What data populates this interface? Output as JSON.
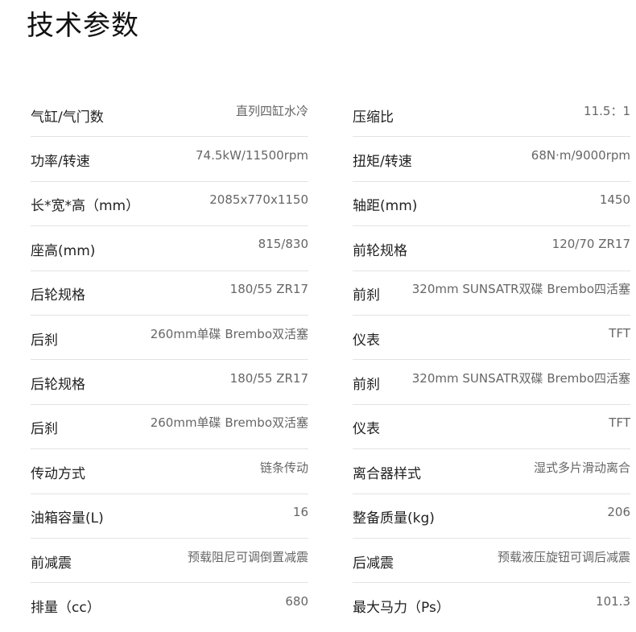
{
  "page": {
    "title": "技术参数"
  },
  "specs": [
    {
      "label": "气缸/气门数",
      "value": "直列四缸水冷"
    },
    {
      "label": "压缩比",
      "value": "11.5：1"
    },
    {
      "label": "功率/转速",
      "value": "74.5kW/11500rpm"
    },
    {
      "label": "扭矩/转速",
      "value": "68N·m/9000rpm"
    },
    {
      "label": "长*宽*高（mm）",
      "value": "2085x770x1150"
    },
    {
      "label": "轴距(mm)",
      "value": "1450"
    },
    {
      "label": "座高(mm)",
      "value": "815/830"
    },
    {
      "label": "前轮规格",
      "value": "120/70 ZR17"
    },
    {
      "label": "后轮规格",
      "value": "180/55 ZR17"
    },
    {
      "label": "前刹",
      "value": "320mm SUNSATR双碟 Brembo四活塞"
    },
    {
      "label": "后刹",
      "value": "260mm单碟 Brembo双活塞"
    },
    {
      "label": "仪表",
      "value": "TFT"
    },
    {
      "label": "后轮规格",
      "value": "180/55 ZR17"
    },
    {
      "label": "前刹",
      "value": "320mm SUNSATR双碟 Brembo四活塞"
    },
    {
      "label": "后刹",
      "value": "260mm单碟 Brembo双活塞"
    },
    {
      "label": "仪表",
      "value": "TFT"
    },
    {
      "label": "传动方式",
      "value": "链条传动"
    },
    {
      "label": "离合器样式",
      "value": "湿式多片滑动离合"
    },
    {
      "label": "油箱容量(L)",
      "value": "16"
    },
    {
      "label": "整备质量(kg)",
      "value": "206"
    },
    {
      "label": "前减震",
      "value": "预载阻尼可调倒置减震"
    },
    {
      "label": "后减震",
      "value": "预载液压旋钮可调后减震"
    },
    {
      "label": "排量（cc）",
      "value": "680"
    },
    {
      "label": "最大马力（Ps）",
      "value": "101.3"
    }
  ]
}
